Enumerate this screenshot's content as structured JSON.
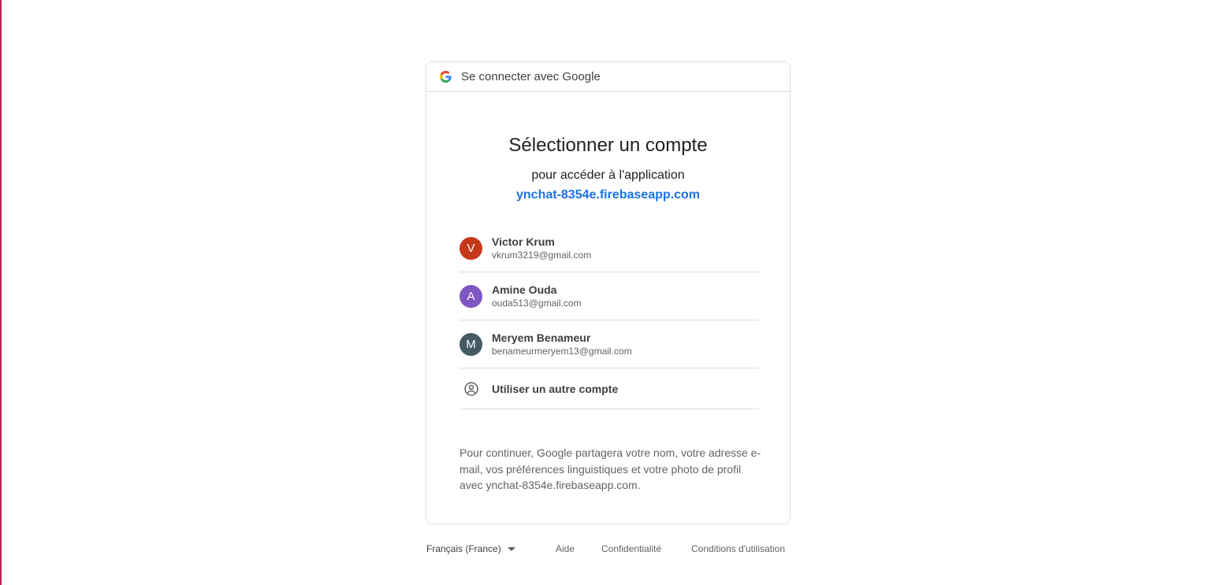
{
  "header": {
    "title": "Se connecter avec Google"
  },
  "main": {
    "title": "Sélectionner un compte",
    "subtitle": "pour accéder à l'application",
    "app_link": "ynchat-8354e.firebaseapp.com"
  },
  "accounts": [
    {
      "initial": "V",
      "name": "Victor Krum",
      "email": "vkrum3219@gmail.com",
      "color": "#c5391a"
    },
    {
      "initial": "A",
      "name": "Amine Ouda",
      "email": "ouda513@gmail.com",
      "color": "#7e57c2"
    },
    {
      "initial": "M",
      "name": "Meryem Benameur",
      "email": "benameurmeryem13@gmail.com",
      "color": "#455a64"
    }
  ],
  "other_account": {
    "label": "Utiliser un autre compte",
    "icon": "account-circle-icon"
  },
  "disclaimer": "Pour continuer, Google partagera votre nom, votre adresse e-mail, vos préférences linguistiques et votre photo de profil avec ynchat-8354e.firebaseapp.com.",
  "footer": {
    "language": "Français (France)",
    "help": "Aide",
    "privacy": "Confidentialité",
    "terms": "Conditions d'utilisation"
  },
  "colors": {
    "accent": "#1a73e8",
    "border": "#dadce0",
    "left_edge": "#c2185b"
  }
}
